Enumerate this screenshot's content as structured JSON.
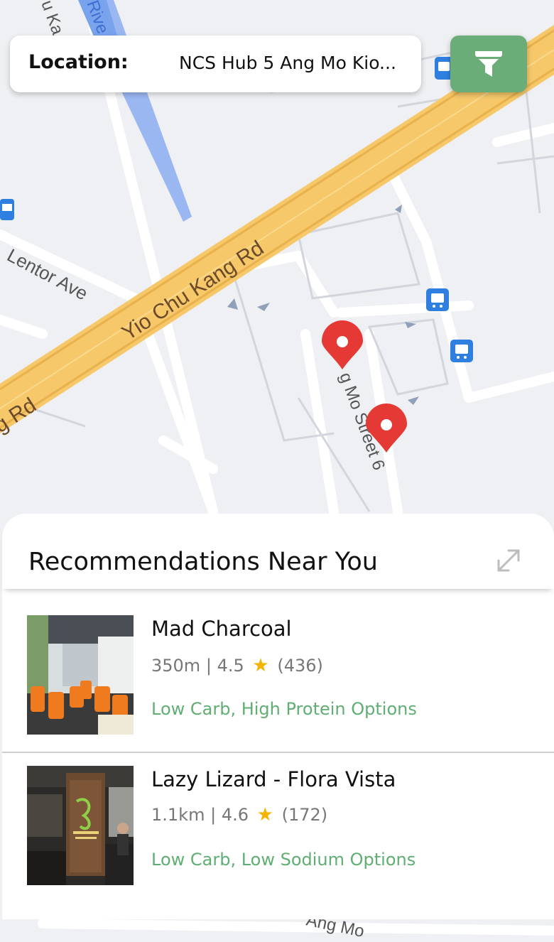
{
  "header": {
    "location_label": "Location:",
    "location_value": "NCS Hub 5 Ang Mo Kio...",
    "filter_icon": "filter-funnel-icon"
  },
  "map": {
    "road_yio_chu_kang": "Yio Chu Kang Rd",
    "road_lentor": "Lentor Ave",
    "road_rd_fragment": "g Rd",
    "road_river_fragment": "Rive",
    "road_top_left_fragment": "u Ka",
    "road_amk_street": "g Mo   Street 6",
    "road_amk_bottom": "Ang Mo",
    "markers": [
      "map-pin-1",
      "map-pin-2"
    ]
  },
  "sheet": {
    "title": "Recommendations Near You",
    "expand_icon": "expand-icon",
    "items": [
      {
        "name": "Mad Charcoal",
        "distance": "350m",
        "separator": "|",
        "rating": "4.5",
        "reviews": "(436)",
        "tags": "Low Carb, High Protein Options"
      },
      {
        "name": "Lazy Lizard - Flora Vista",
        "distance": "1.1km",
        "separator": "|",
        "rating": "4.6",
        "reviews": "(172)",
        "tags": "Low Carb, Low Sodium Options"
      }
    ]
  },
  "colors": {
    "accent_green": "#6aad78",
    "tag_green": "#5fae72",
    "marker_red": "#e53935",
    "highway": "#f6c86a",
    "star": "#f5b301"
  }
}
